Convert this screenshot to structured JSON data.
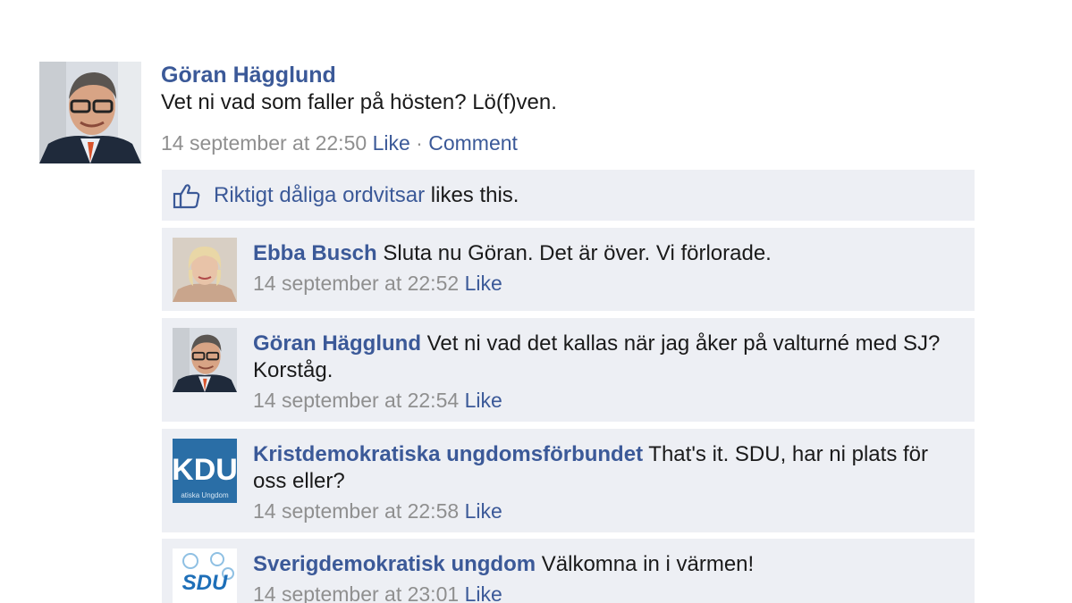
{
  "post": {
    "author": "Göran Hägglund",
    "text": "Vet ni vad som faller på hösten? Lö(f)ven.",
    "timestamp": "14 september at 22:50",
    "like_label": "Like",
    "separator": "·",
    "comment_label": "Comment"
  },
  "likes": {
    "icon": "thumbs-up-icon",
    "liker": "Riktigt dåliga ordvitsar",
    "suffix": "likes this."
  },
  "comments": [
    {
      "author": "Ebba Busch",
      "text": "Sluta nu Göran. Det är över. Vi förlorade.",
      "timestamp": "14 september at 22:52",
      "like_label": "Like"
    },
    {
      "author": "Göran Hägglund",
      "text": "Vet ni vad det kallas när jag åker på valturné med SJ? Korståg.",
      "timestamp": "14 september at 22:54",
      "like_label": "Like"
    },
    {
      "author": "Kristdemokratiska ungdomsförbundet",
      "text": "That's it. SDU, har ni plats för oss eller?",
      "timestamp": "14 september at 22:58",
      "like_label": "Like",
      "logo_text": "KDU",
      "logo_caption": "atiska Ungdom"
    },
    {
      "author": "Sverigdemokratisk ungdom",
      "text": "Välkomna in i värmen!",
      "timestamp": "14 september at 23:01",
      "like_label": "Like",
      "logo_text": "SDU"
    }
  ],
  "colors": {
    "link": "#3b5998",
    "meta": "#8f8f8f",
    "box_bg": "#edeff4"
  }
}
